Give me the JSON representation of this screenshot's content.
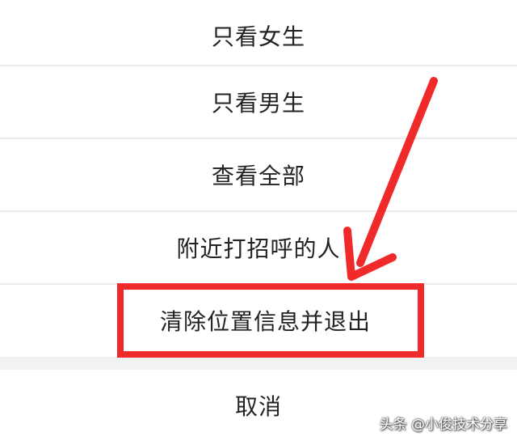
{
  "action_sheet": {
    "items": [
      {
        "label": "只看女生"
      },
      {
        "label": "只看男生"
      },
      {
        "label": "查看全部"
      },
      {
        "label": "附近打招呼的人"
      },
      {
        "label": "清除位置信息并退出"
      }
    ],
    "cancel_label": "取消"
  },
  "annotation": {
    "highlight_color": "#f02a2a",
    "arrow_color": "#f02a2a"
  },
  "watermark": {
    "text": "头条 @小俊技术分享"
  }
}
